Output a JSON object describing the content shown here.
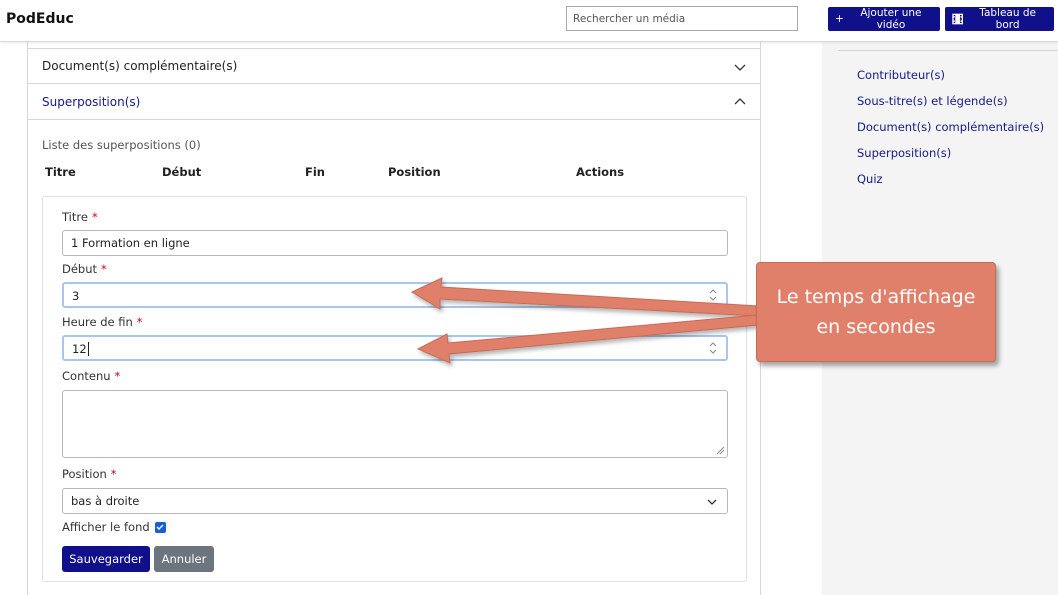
{
  "header": {
    "brand": "PodEduc",
    "search_placeholder": "Rechercher un média",
    "add_video_label": "Ajouter une vidéo",
    "dashboard_label": "Tableau de bord"
  },
  "sidebar": {
    "items": [
      {
        "label": "Contributeur(s)"
      },
      {
        "label": "Sous-titre(s) et légende(s)"
      },
      {
        "label": "Document(s) complémentaire(s)"
      },
      {
        "label": "Superposition(s)"
      },
      {
        "label": "Quiz"
      }
    ]
  },
  "accordion": {
    "documents_label": "Document(s) complémentaire(s)",
    "overlays_label": "Superposition(s)"
  },
  "overlays": {
    "list_title": "Liste des superpositions (0)",
    "columns": [
      "Titre",
      "Début",
      "Fin",
      "Position",
      "Actions"
    ]
  },
  "form": {
    "title_label": "Titre",
    "title_value": "1 Formation en ligne",
    "start_label": "Début",
    "start_value": "3",
    "end_label": "Heure de fin",
    "end_value": "12",
    "content_label": "Contenu",
    "content_value": "",
    "position_label": "Position",
    "position_value": "bas à droite",
    "show_background_label": "Afficher le fond",
    "show_background_checked": true,
    "required_marker": "*",
    "save_label": "Sauvegarder",
    "cancel_label": "Annuler"
  },
  "annotation": {
    "line1": "Le temps d'affichage",
    "line2": "en secondes"
  },
  "colors": {
    "primary": "#10108a",
    "link": "#141a8c",
    "secondary": "#6c757d",
    "required": "#d0021b",
    "callout": "#e0806b"
  }
}
